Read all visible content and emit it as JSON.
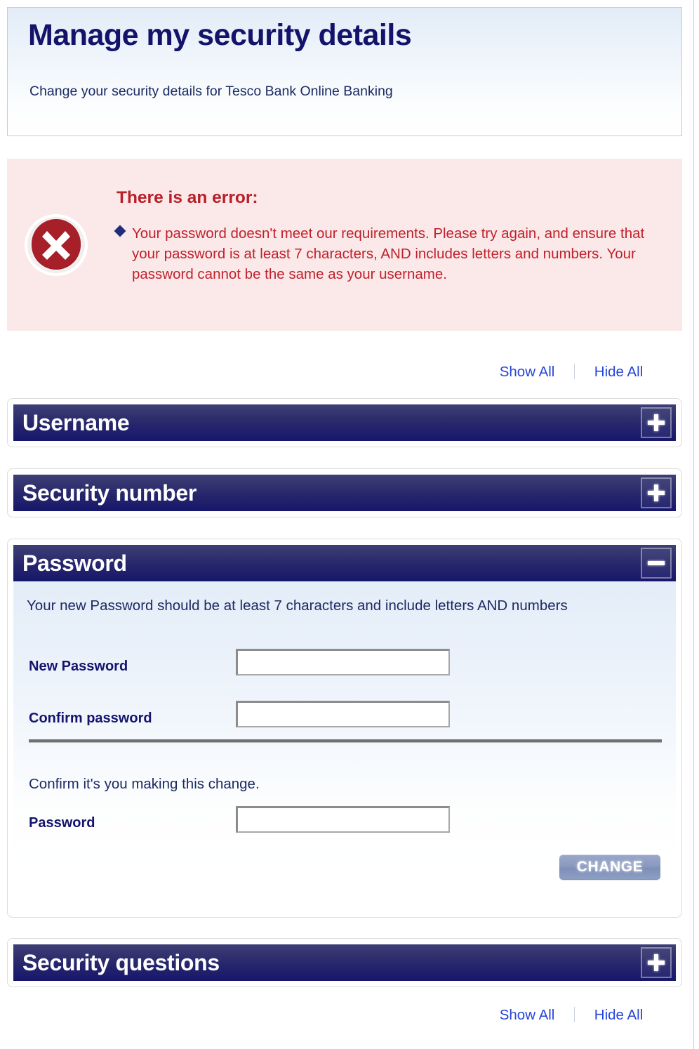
{
  "page": {
    "title": "Manage my security details",
    "subtitle": "Change your security details for Tesco Bank Online Banking"
  },
  "error": {
    "heading": "There is an error:",
    "icon": "error-cross-icon",
    "messages": [
      "Your password doesn't meet our requirements. Please try again, and ensure that your password is at least 7 characters, AND includes letters and numbers. Your password cannot be the same as your username."
    ]
  },
  "toggle_links": {
    "show_all": "Show All",
    "hide_all": "Hide All"
  },
  "accordion": {
    "sections": [
      {
        "label": "Username",
        "expanded": false,
        "toggle_icon": "plus-icon"
      },
      {
        "label": "Security number",
        "expanded": false,
        "toggle_icon": "plus-icon"
      },
      {
        "label": "Password",
        "expanded": true,
        "toggle_icon": "minus-icon"
      },
      {
        "label": "Security questions",
        "expanded": false,
        "toggle_icon": "plus-icon"
      }
    ]
  },
  "password_panel": {
    "note": "Your new Password should be at least 7 characters and include letters AND numbers",
    "new_password_label": "New Password",
    "new_password_value": "",
    "confirm_password_label": "Confirm password",
    "confirm_password_value": "",
    "confirm_note": "Confirm it's you making this change.",
    "current_password_label": "Password",
    "current_password_value": "",
    "submit_label": "CHANGE"
  },
  "colors": {
    "brand_navy": "#14146e",
    "header_gradient_top": "#e3ecf7",
    "error_bg": "#fbe9e9",
    "error_text": "#c0202b",
    "error_heading": "#b81f28",
    "link_blue": "#2546d8",
    "accordion_top": "#3f3f77",
    "accordion_bottom": "#17176b",
    "button_blue": "#8a9abf"
  }
}
